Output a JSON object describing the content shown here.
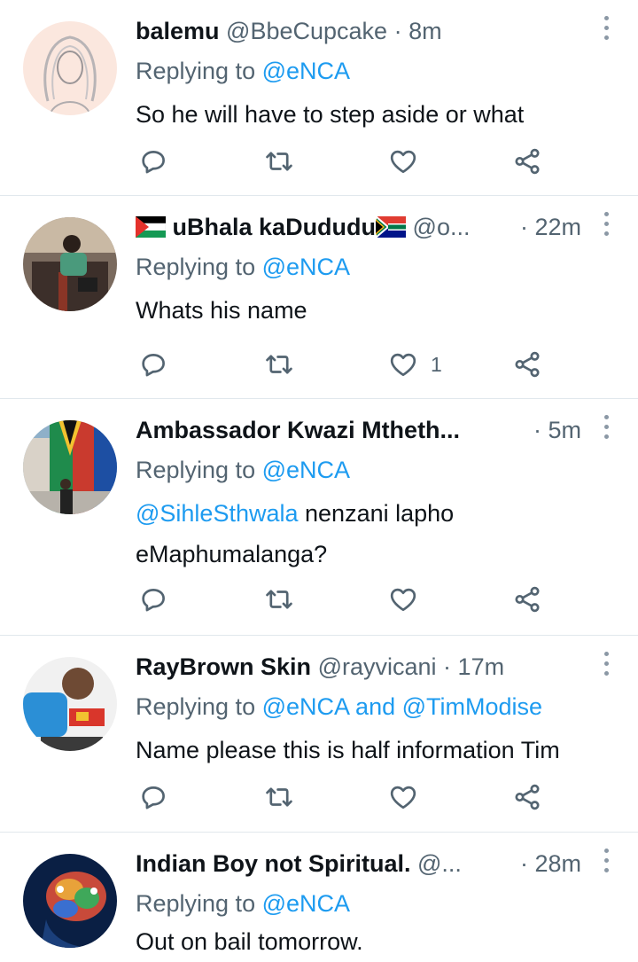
{
  "tweets": [
    {
      "name": "balemu",
      "handle": "@BbeCupcake",
      "dot": "·",
      "time": "8m",
      "replying_prefix": "Replying to ",
      "replying_to": "@eNCA",
      "replying_and": "",
      "replying_to2": "",
      "mention": "",
      "text": "So he will have to step aside or what",
      "likes": ""
    },
    {
      "name": "uBhala kaDududu",
      "handle": "@o...",
      "dot": "·",
      "time": "22m",
      "replying_prefix": "Replying to ",
      "replying_to": "@eNCA",
      "replying_and": "",
      "replying_to2": "",
      "mention": "",
      "text": "Whats his name",
      "likes": "1"
    },
    {
      "name": "Ambassador Kwazi Mtheth...",
      "handle": "",
      "dot": "·",
      "time": "5m",
      "replying_prefix": "Replying to ",
      "replying_to": "@eNCA",
      "replying_and": "",
      "replying_to2": "",
      "mention": "@SihleSthwala",
      "text": " nenzani lapho eMaphumalanga?",
      "likes": ""
    },
    {
      "name": "RayBrown Skin",
      "handle": "@rayvicani",
      "dot": "·",
      "time": "17m",
      "replying_prefix": "Replying to ",
      "replying_to": "@eNCA",
      "replying_and": " and ",
      "replying_to2": "@TimModise",
      "mention": "",
      "text": "Name please this is half information Tim",
      "likes": ""
    },
    {
      "name": "Indian Boy not Spiritual.",
      "handle": "@...",
      "dot": "·",
      "time": "28m",
      "replying_prefix": "Replying to ",
      "replying_to": "@eNCA",
      "replying_and": "",
      "replying_to2": "",
      "mention": "",
      "text": "Out on bail tomorrow.",
      "likes": ""
    }
  ],
  "icons": {
    "reply": "reply-icon",
    "retweet": "retweet-icon",
    "like": "heart-icon",
    "share": "share-icon",
    "more": "more-vertical-icon"
  },
  "colors": {
    "link": "#1d9bf0",
    "secondary": "#536471",
    "divider": "#e1e8ed"
  }
}
